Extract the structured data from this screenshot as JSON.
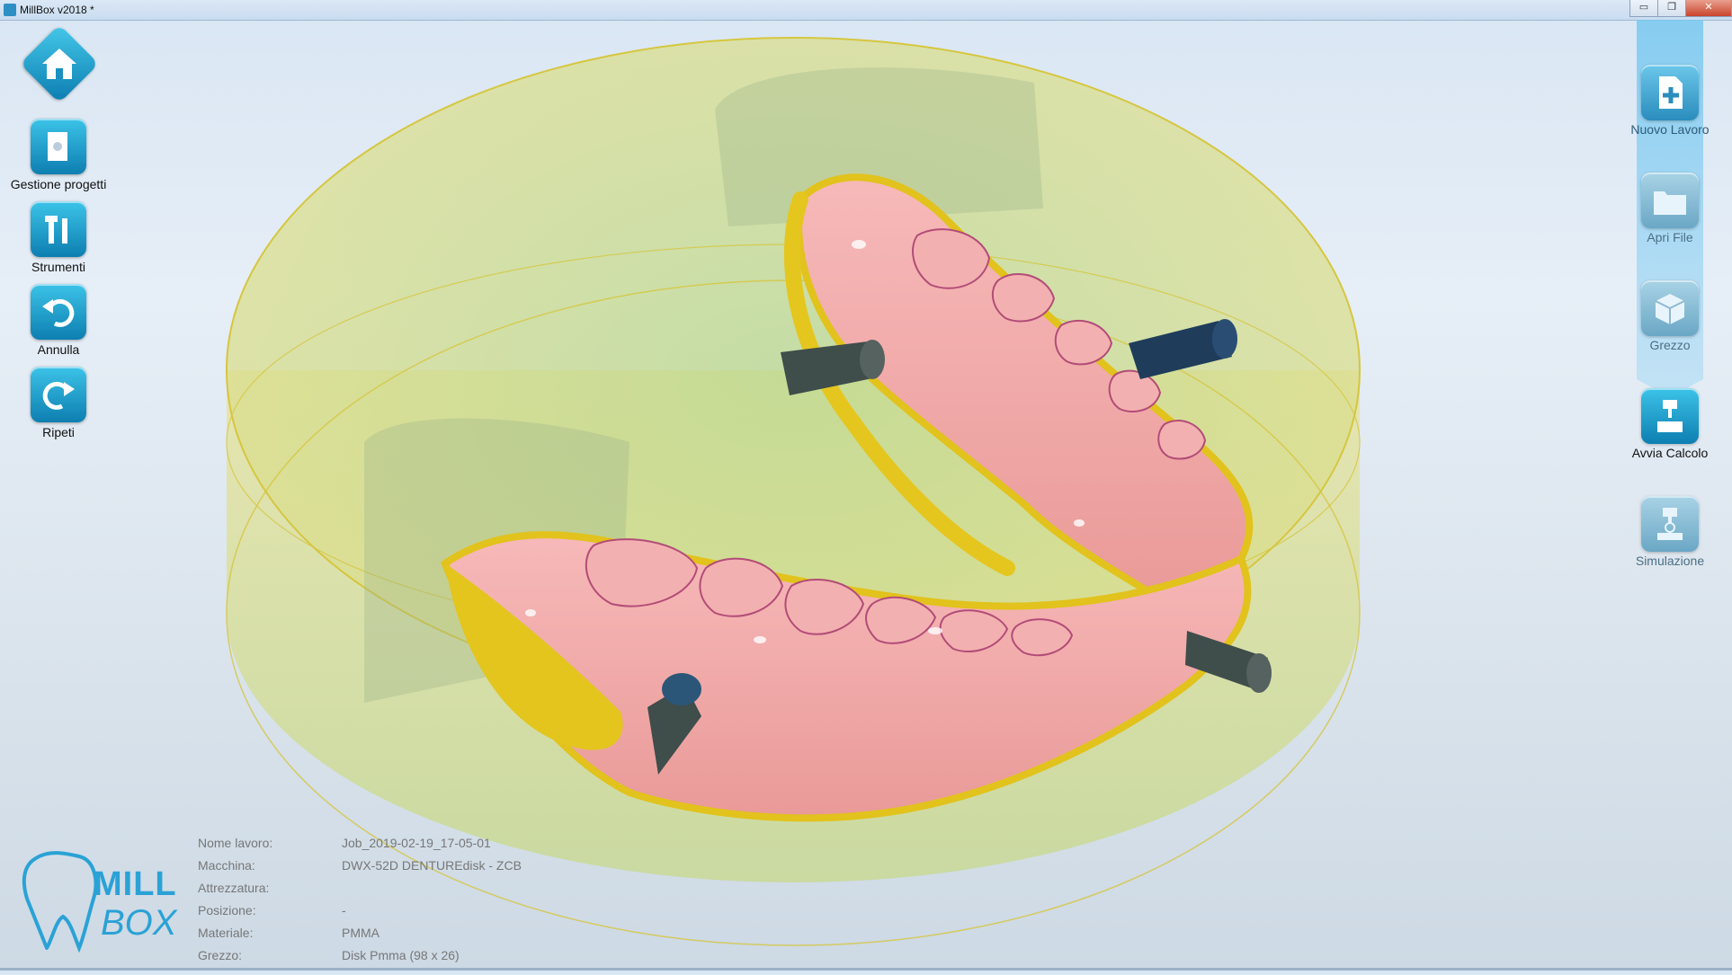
{
  "window": {
    "title": "MillBox v2018 *",
    "close": "✕",
    "maximize": "❐",
    "minimize": "▭"
  },
  "left_toolbar": {
    "home": "Home",
    "items": [
      {
        "label": "Gestione progetti",
        "icon": "door-icon"
      },
      {
        "label": "Strumenti",
        "icon": "tools-icon"
      },
      {
        "label": "Annulla",
        "icon": "undo-icon"
      },
      {
        "label": "Ripeti",
        "icon": "redo-icon"
      }
    ]
  },
  "right_toolbar": {
    "items": [
      {
        "label": "Nuovo Lavoro",
        "icon": "new-file-icon"
      },
      {
        "label": "Apri File",
        "icon": "folder-icon"
      },
      {
        "label": "Grezzo",
        "icon": "stock-box-icon"
      },
      {
        "label": "Avvia Calcolo",
        "icon": "mill-calc-icon"
      },
      {
        "label": "Simulazione",
        "icon": "simulation-icon"
      }
    ]
  },
  "job_info": {
    "rows": [
      {
        "key": "Nome lavoro:",
        "value": "Job_2019-02-19_17-05-01"
      },
      {
        "key": "Macchina:",
        "value": "DWX-52D DENTUREdisk - ZCB"
      },
      {
        "key": "Attrezzatura:",
        "value": ""
      },
      {
        "key": "Posizione:",
        "value": "-"
      },
      {
        "key": "Materiale:",
        "value": "PMMA"
      },
      {
        "key": "Grezzo:",
        "value": "Disk Pmma (98 x 26)"
      }
    ]
  },
  "logo": {
    "line1": "MILL",
    "line2": "BOX"
  },
  "colors": {
    "accent": "#1aa3d6",
    "disk": "#e4e27a",
    "denture": "#f0a5a5",
    "gum": "#e8d020",
    "pin": "#3d4a4a"
  }
}
